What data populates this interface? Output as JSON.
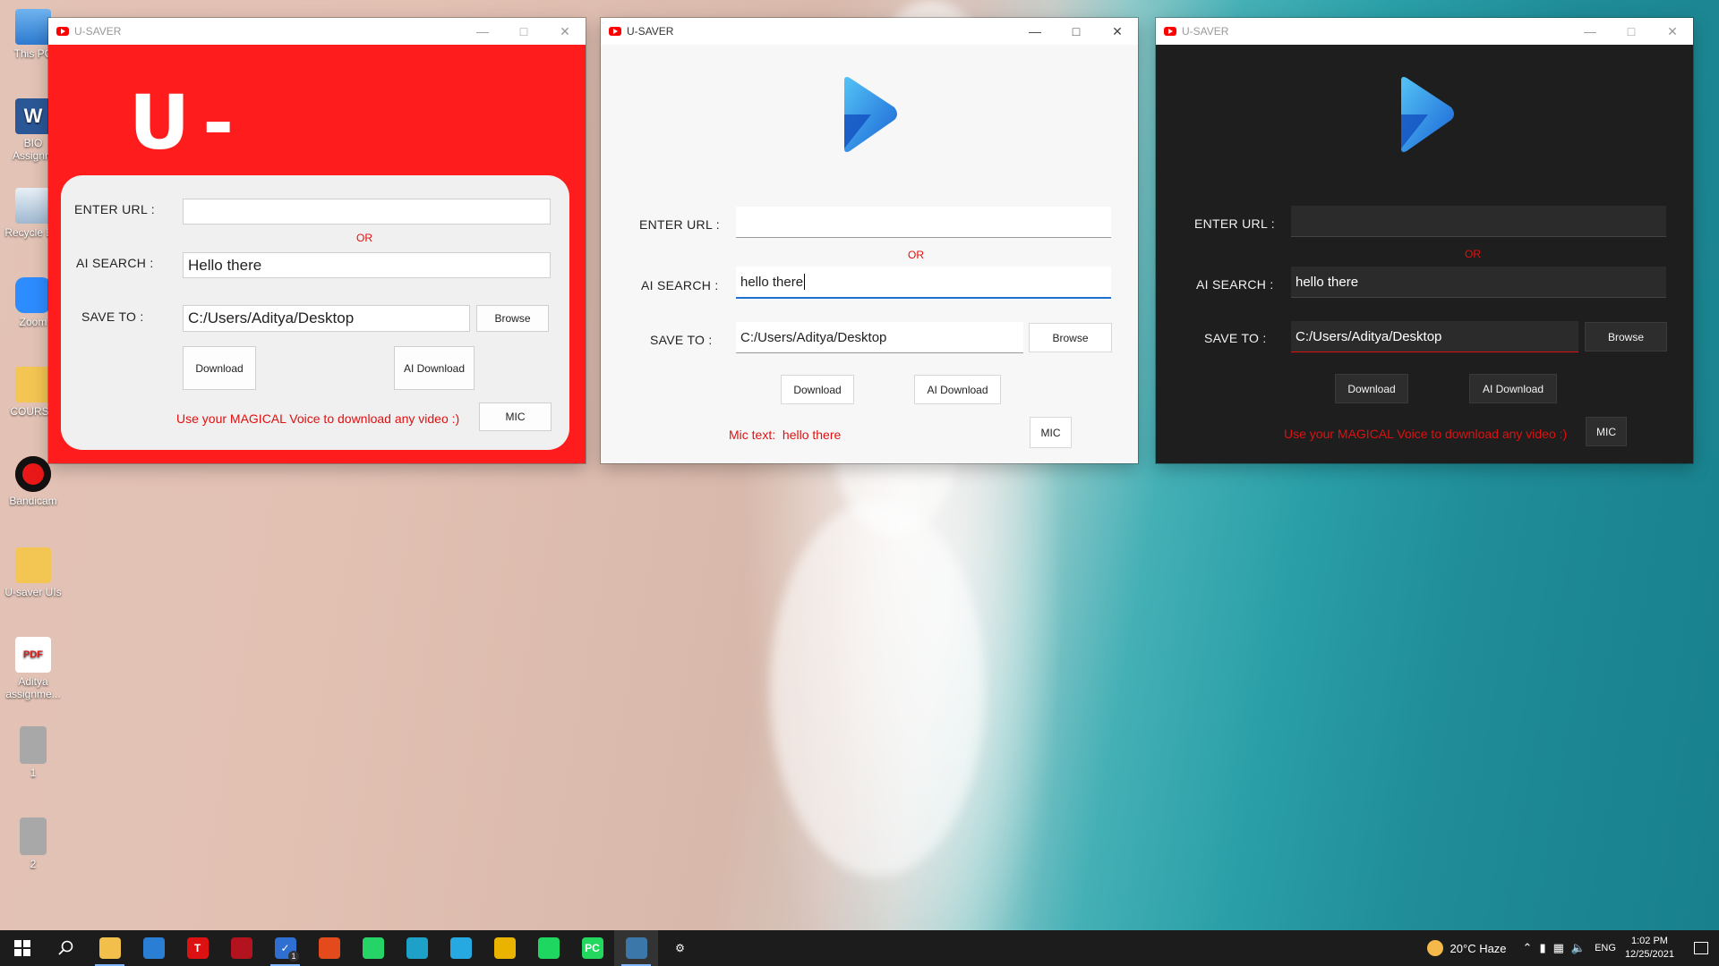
{
  "desktop": {
    "icons": [
      {
        "label": "This PC",
        "icon": "this-pc-icon",
        "color": "#3c8de0"
      },
      {
        "label": "BIO Assignm",
        "icon": "word-doc-icon",
        "color": "#2b5797"
      },
      {
        "label": "Recycle Bin",
        "icon": "recycle-bin-icon",
        "color": "#9fb8d0"
      },
      {
        "label": "Zoom",
        "icon": "zoom-icon",
        "color": "#2d8cff"
      },
      {
        "label": "COURSE",
        "icon": "folder-icon",
        "color": "#f3c553"
      },
      {
        "label": "Bandicam",
        "icon": "bandicam-icon",
        "color": "#e81818"
      },
      {
        "label": "U-saver UIs",
        "icon": "folder-icon",
        "color": "#f3c553"
      },
      {
        "label": "Aditya assignme...",
        "icon": "pdf-icon",
        "color": "#d21f1f"
      },
      {
        "label": "1",
        "icon": "image-file-icon",
        "color": "#9a9a9a"
      },
      {
        "label": "2",
        "icon": "image-file-icon",
        "color": "#9a9a9a"
      }
    ]
  },
  "windows": {
    "red": {
      "title": "U-SAVER",
      "logo_text": "U-S▷VER",
      "url_label": "ENTER URL :",
      "url_value": "",
      "or_label": "OR",
      "ai_label": "AI SEARCH :",
      "ai_value": "Hello there",
      "save_label": "SAVE TO :",
      "save_value": "C:/Users/Aditya/Desktop",
      "browse_label": "Browse",
      "download_label": "Download",
      "ai_download_label": "AI Download",
      "voice_text": "Use your MAGICAL Voice to download any video :)",
      "mic_label": "MIC"
    },
    "light": {
      "title": "U-SAVER",
      "url_label": "ENTER URL :",
      "url_value": "",
      "or_label": "OR",
      "ai_label": "AI SEARCH :",
      "ai_value": "hello there",
      "save_label": "SAVE TO :",
      "save_value": "C:/Users/Aditya/Desktop",
      "browse_label": "Browse",
      "download_label": "Download",
      "ai_download_label": "AI Download",
      "mic_prefix": "Mic text:",
      "mic_text": "hello there",
      "mic_label": "MIC"
    },
    "dark": {
      "title": "U-SAVER",
      "url_label": "ENTER URL :",
      "url_value": "",
      "or_label": "OR",
      "ai_label": "AI SEARCH :",
      "ai_value": "hello there",
      "save_label": "SAVE TO :",
      "save_value": "C:/Users/Aditya/Desktop",
      "browse_label": "Browse",
      "download_label": "Download",
      "ai_download_label": "AI Download",
      "voice_text": "Use your MAGICAL Voice to download any video :)",
      "mic_label": "MIC"
    }
  },
  "taskbar": {
    "apps": [
      {
        "name": "file-explorer-icon",
        "glyph": "",
        "color": "#f2c04a"
      },
      {
        "name": "mail-icon",
        "glyph": "",
        "color": "#2a7fd4"
      },
      {
        "name": "t-app-icon",
        "glyph": "T",
        "color": "#d11"
      },
      {
        "name": "game-launcher-icon",
        "glyph": "",
        "color": "#b3121f"
      },
      {
        "name": "todo-icon",
        "glyph": "✓",
        "color": "#2f6fd1",
        "badge": "1"
      },
      {
        "name": "office-icon",
        "glyph": "",
        "color": "#e34b1c"
      },
      {
        "name": "whatsapp-icon",
        "glyph": "",
        "color": "#25d366"
      },
      {
        "name": "edge-icon",
        "glyph": "",
        "color": "#1da1c8"
      },
      {
        "name": "cortana-icon",
        "glyph": "",
        "color": "#26a8e0"
      },
      {
        "name": "chrome-icon",
        "glyph": "",
        "color": "#e9b300"
      },
      {
        "name": "spotify-icon",
        "glyph": "",
        "color": "#1ed760"
      },
      {
        "name": "pycharm-icon",
        "glyph": "PC",
        "color": "#22d85e"
      },
      {
        "name": "python-icon",
        "glyph": "",
        "color": "#3b77a8"
      },
      {
        "name": "settings-icon",
        "glyph": "⚙",
        "color": "#1c1c1c"
      }
    ],
    "weather": "20°C  Haze",
    "language": "ENG",
    "time": "1:02 PM",
    "date": "12/25/2021"
  }
}
